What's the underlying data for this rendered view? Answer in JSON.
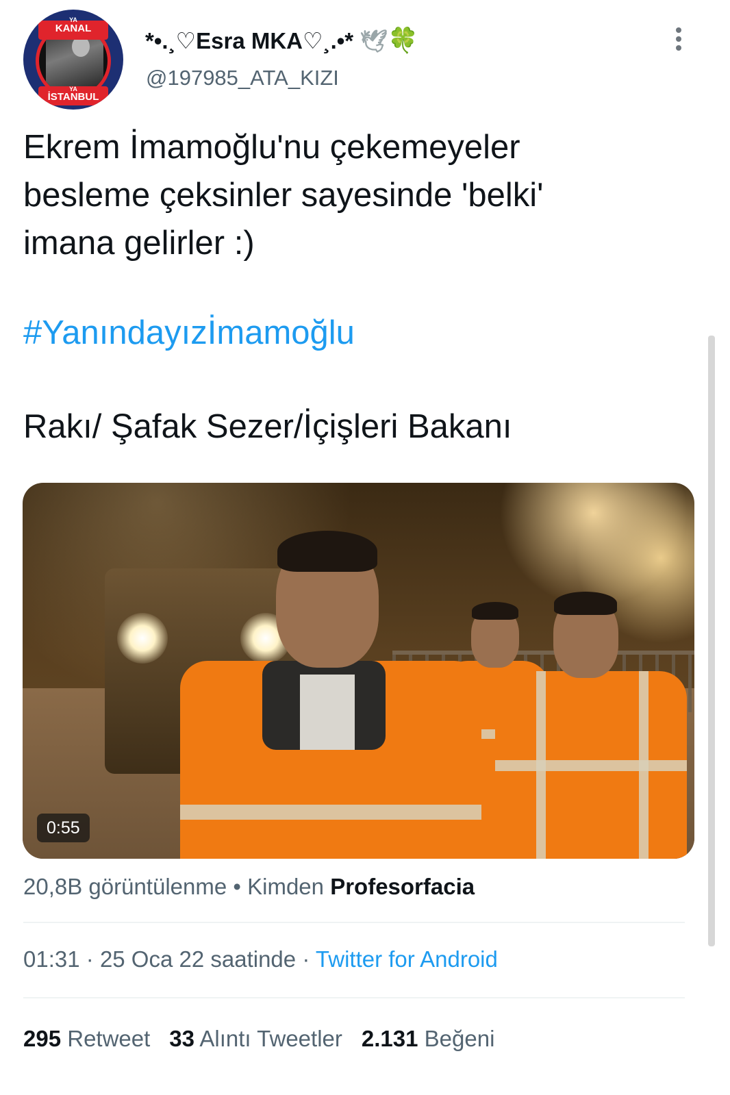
{
  "author": {
    "display_name": "*•.¸♡Esra MKA♡¸.•*",
    "name_emoji_1": "🕊",
    "name_emoji_2": "🍀",
    "handle": "@197985_ATA_KIZI",
    "avatar_text_top_small": "YA",
    "avatar_text_top": "KANAL",
    "avatar_text_bottom_small": "YA",
    "avatar_text_bottom": "İSTANBUL"
  },
  "tweet": {
    "text_lines": [
      "Ekrem İmamoğlu'nu çekemeyeler",
      "besleme çeksinler sayesinde 'belki'",
      "imana gelirler :)"
    ],
    "hashtag": "#Yanındayızİmamoğlu",
    "extra_line": "Rakı/ Şafak Sezer/İçişleri Bakanı"
  },
  "video": {
    "duration": "0:55",
    "views": "20,8B görüntülenme",
    "separator": "•",
    "from_label": "Kimden",
    "from_user": "Profesorfacia"
  },
  "timestamp": {
    "time": "01:31",
    "date": "25 Oca 22 saatinde",
    "dot": "·",
    "source": "Twitter for Android"
  },
  "stats": {
    "retweets": "295",
    "retweets_label": "Retweet",
    "quotes": "33",
    "quotes_label": "Alıntı Tweetler",
    "likes": "2.131",
    "likes_label": "Beğeni"
  },
  "colors": {
    "link": "#1d9bf0",
    "secondary_text": "#536471",
    "primary_text": "#0f1419"
  },
  "icons": {
    "more": "more-vertical-icon"
  }
}
